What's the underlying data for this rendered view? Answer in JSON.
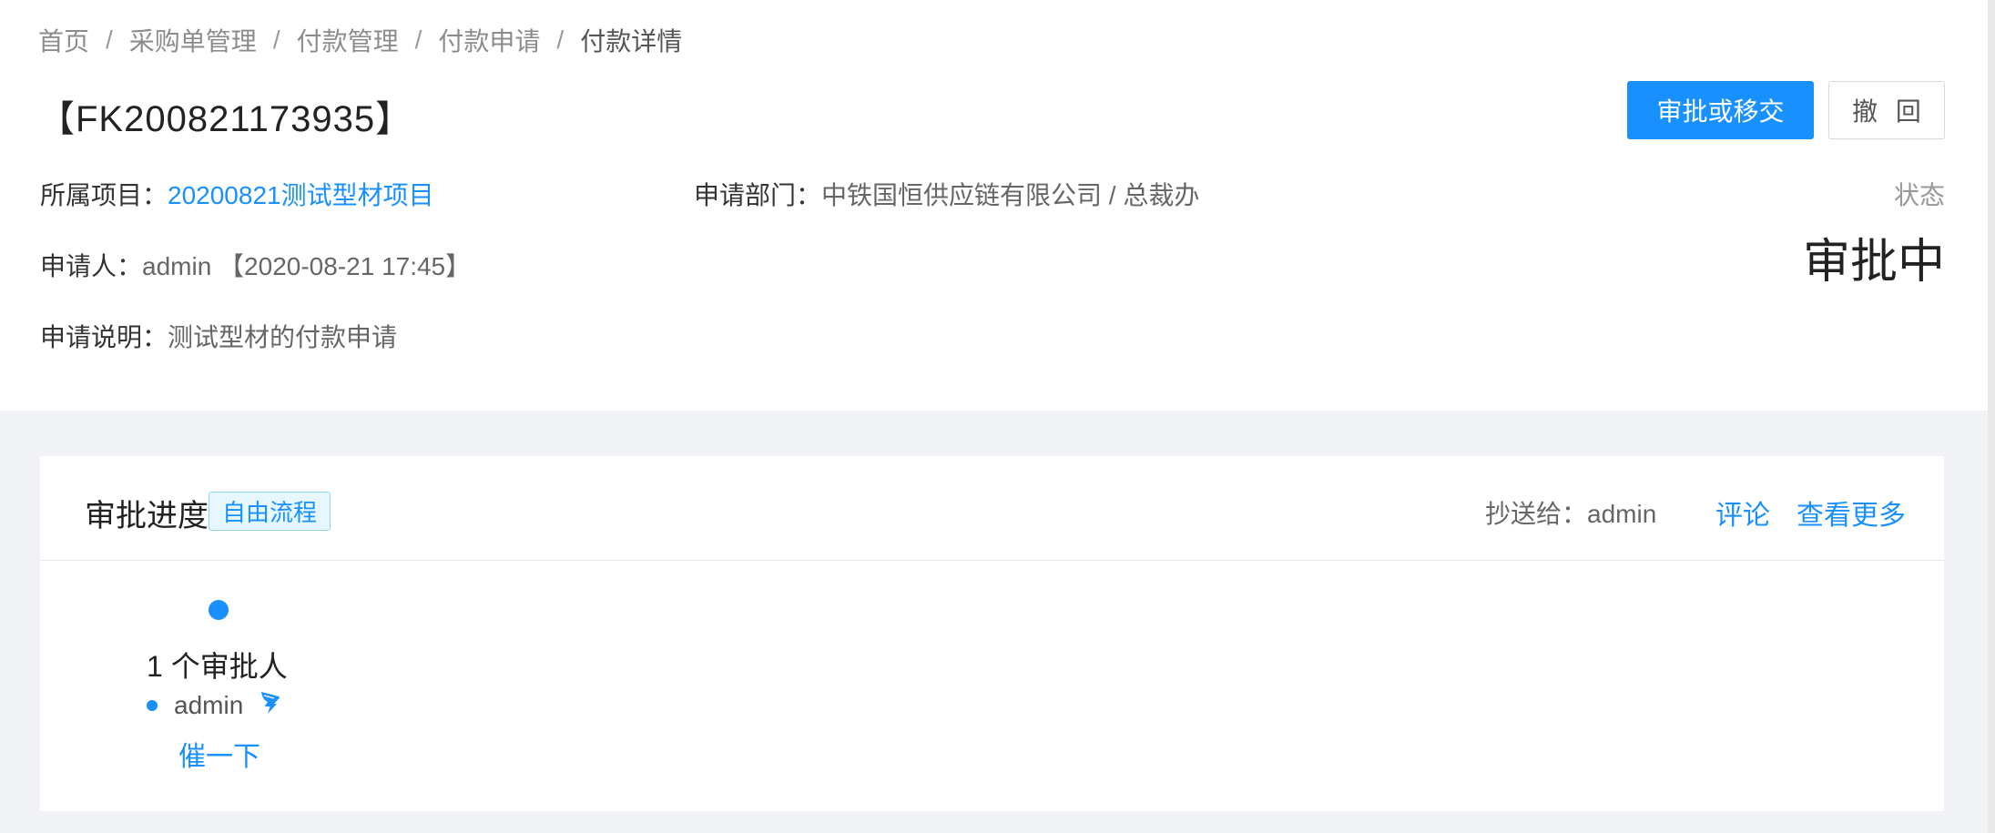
{
  "breadcrumb": {
    "items": [
      "首页",
      "采购单管理",
      "付款管理",
      "付款申请"
    ],
    "current": "付款详情",
    "separator": "/"
  },
  "page_title": "【FK200821173935】",
  "actions": {
    "approve_label": "审批或移交",
    "revoke_label": "撤 回"
  },
  "info": {
    "project_label": "所属项目：",
    "project_value": "20200821测试型材项目",
    "dept_label": "申请部门：",
    "dept_value": "中铁国恒供应链有限公司 / 总裁办",
    "applicant_label": "申请人：",
    "applicant_value": "admin 【2020-08-21 17:45】",
    "desc_label": "申请说明：",
    "desc_value": "测试型材的付款申请"
  },
  "status": {
    "label": "状态",
    "value": "审批中"
  },
  "progress": {
    "title": "审批进度",
    "tag": "自由流程",
    "cc": "抄送给：admin",
    "comment_link": "评论",
    "more_link": "查看更多",
    "node_title": "1 个审批人",
    "approver_name": "admin",
    "approver_icon": "dingtalk-icon",
    "urge_link": "催一下"
  },
  "colors": {
    "primary": "#1890ff",
    "background": "#f0f2f5",
    "tag_bg": "#e6f7ff"
  }
}
